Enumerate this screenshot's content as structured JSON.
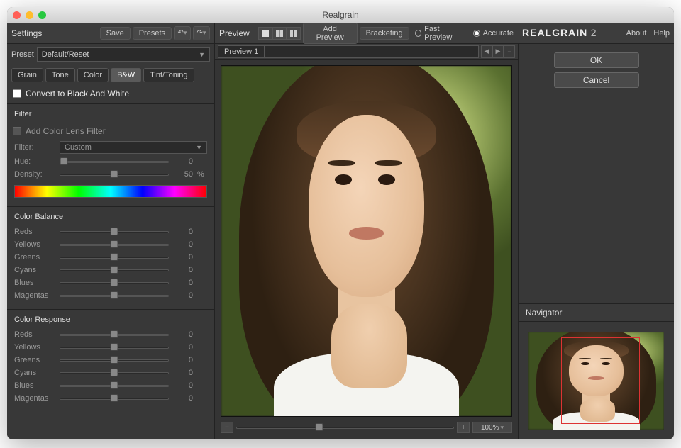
{
  "window": {
    "title": "Realgrain"
  },
  "toolbar": {
    "settings_label": "Settings",
    "save_label": "Save",
    "presets_label": "Presets",
    "preview_label": "Preview",
    "add_preview_label": "Add Preview",
    "bracketing_label": "Bracketing",
    "fast_preview_label": "Fast Preview",
    "accurate_label": "Accurate",
    "accurate_selected": true,
    "logo_main": "REALGRAIN",
    "logo_suffix": "2",
    "about_label": "About",
    "help_label": "Help"
  },
  "preset": {
    "label": "Preset",
    "value": "Default/Reset"
  },
  "tabs": [
    "Grain",
    "Tone",
    "Color",
    "B&W",
    "Tint/Toning"
  ],
  "active_tab": "B&W",
  "bw": {
    "convert_label": "Convert to Black And White",
    "convert_checked": false,
    "filter": {
      "head": "Filter",
      "add_label": "Add Color Lens Filter",
      "add_checked": false,
      "filter_label": "Filter:",
      "filter_value": "Custom",
      "hue_label": "Hue:",
      "hue_value": "0",
      "density_label": "Density:",
      "density_value": "50",
      "density_unit": "%"
    },
    "color_balance": {
      "head": "Color Balance",
      "rows": [
        {
          "label": "Reds",
          "value": "0"
        },
        {
          "label": "Yellows",
          "value": "0"
        },
        {
          "label": "Greens",
          "value": "0"
        },
        {
          "label": "Cyans",
          "value": "0"
        },
        {
          "label": "Blues",
          "value": "0"
        },
        {
          "label": "Magentas",
          "value": "0"
        }
      ]
    },
    "color_response": {
      "head": "Color Response",
      "rows": [
        {
          "label": "Reds",
          "value": "0"
        },
        {
          "label": "Yellows",
          "value": "0"
        },
        {
          "label": "Greens",
          "value": "0"
        },
        {
          "label": "Cyans",
          "value": "0"
        },
        {
          "label": "Blues",
          "value": "0"
        },
        {
          "label": "Magentas",
          "value": "0"
        }
      ]
    }
  },
  "preview": {
    "tab_label": "Preview 1",
    "zoom_value": "100%"
  },
  "right": {
    "ok_label": "OK",
    "cancel_label": "Cancel",
    "navigator_label": "Navigator"
  }
}
